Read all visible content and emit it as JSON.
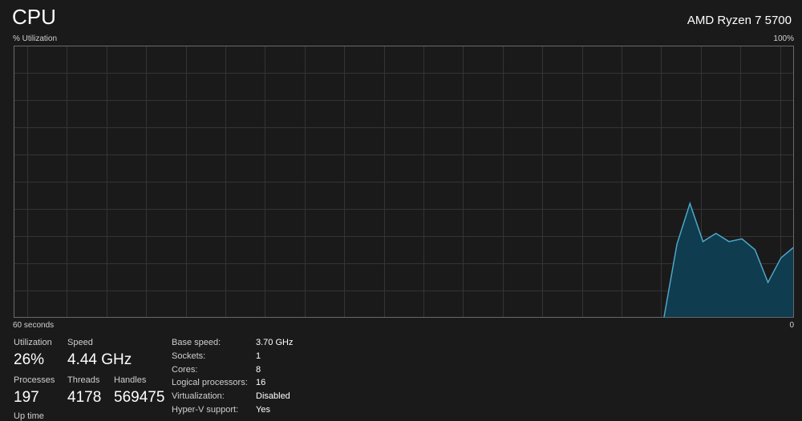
{
  "header": {
    "title": "CPU",
    "processor": "AMD Ryzen 7 5700"
  },
  "graph": {
    "y_label": "% Utilization",
    "y_max_label": "100%",
    "x_label": "60 seconds",
    "x_min_label": "0"
  },
  "chart_data": {
    "type": "area",
    "title": "% Utilization",
    "xlabel": "60 seconds",
    "ylim": [
      0,
      100
    ],
    "xlim": [
      60,
      0
    ],
    "seconds_ago": [
      10,
      9,
      8,
      7,
      6,
      5,
      4,
      3,
      2,
      1,
      0
    ],
    "values": [
      0,
      27,
      42,
      28,
      31,
      28,
      29,
      25,
      13,
      22,
      26
    ],
    "colors": {
      "line": "#4ea6c8",
      "fill": "#0f3c4e",
      "grid": "#343434",
      "border": "#6a6a6a"
    }
  },
  "stats": {
    "utilization": {
      "label": "Utilization",
      "value": "26%"
    },
    "speed": {
      "label": "Speed",
      "value": "4.44 GHz"
    },
    "processes": {
      "label": "Processes",
      "value": "197"
    },
    "threads": {
      "label": "Threads",
      "value": "4178"
    },
    "handles": {
      "label": "Handles",
      "value": "569475"
    },
    "uptime": {
      "label": "Up time"
    }
  },
  "specs": [
    {
      "key": "Base speed:",
      "value": "3.70 GHz"
    },
    {
      "key": "Sockets:",
      "value": "1"
    },
    {
      "key": "Cores:",
      "value": "8"
    },
    {
      "key": "Logical processors:",
      "value": "16"
    },
    {
      "key": "Virtualization:",
      "value": "Disabled"
    },
    {
      "key": "Hyper-V support:",
      "value": "Yes"
    }
  ]
}
